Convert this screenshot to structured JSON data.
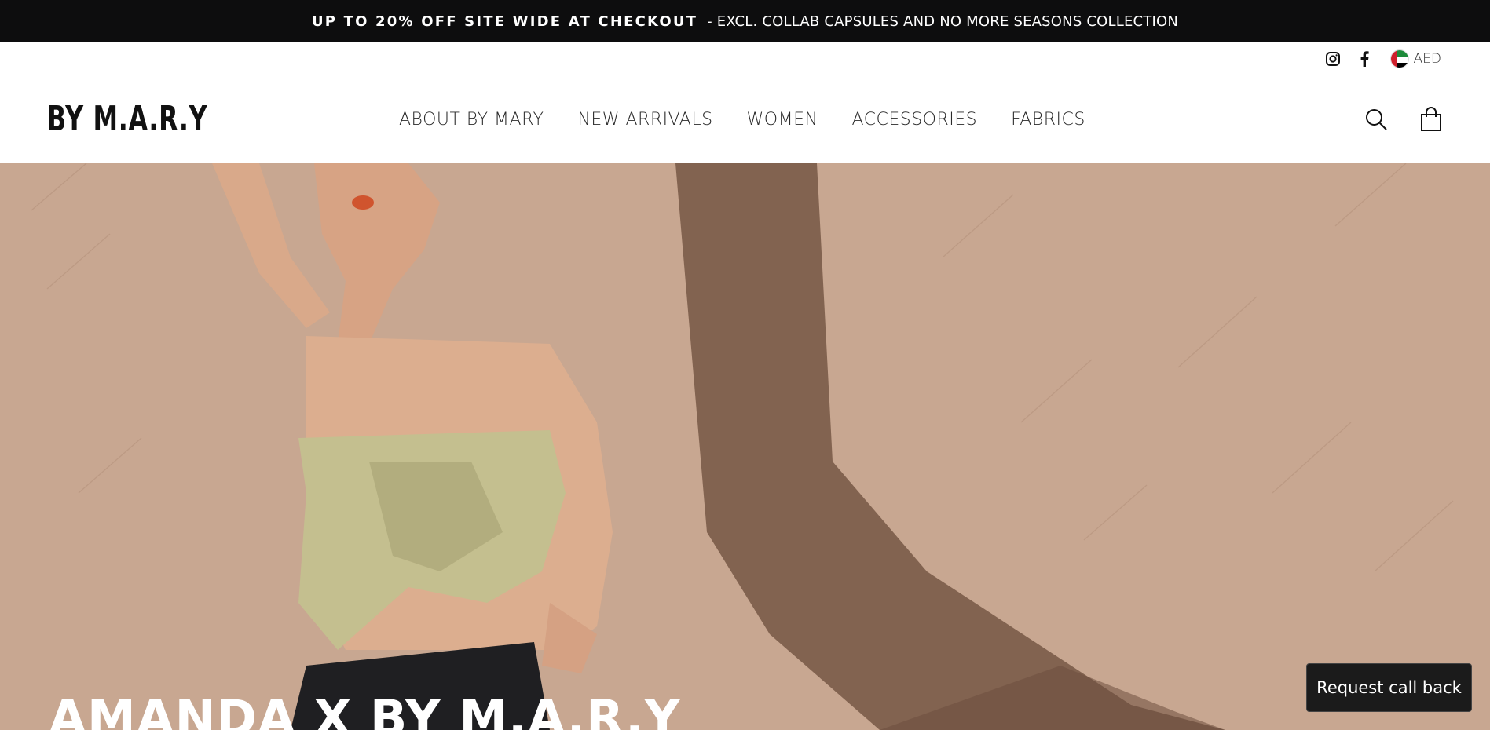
{
  "announcement": {
    "bold_text": "UP TO 20% OFF SITE WIDE AT CHECKOUT",
    "rest_text": "- EXCL. COLLAB CAPSULES AND NO MORE SEASONS COLLECTION"
  },
  "utility": {
    "social_icons": [
      "instagram-icon",
      "facebook-icon"
    ],
    "currency": {
      "flag": "uae-flag",
      "label": "AED"
    }
  },
  "header": {
    "logo": "BY M.A.R.Y",
    "nav": [
      {
        "label": "ABOUT BY MARY"
      },
      {
        "label": "NEW ARRIVALS"
      },
      {
        "label": "WOMEN"
      },
      {
        "label": "ACCESSORIES"
      },
      {
        "label": "FABRICS"
      }
    ],
    "icons": [
      "search-icon",
      "cart-icon"
    ]
  },
  "hero": {
    "title": "AMANDA X BY M.A.R.Y",
    "background_color": "#c7a690"
  },
  "callback_button": {
    "label": "Request call back"
  },
  "colors": {
    "announcement_bg": "#0d0d0e",
    "text": "#111111",
    "callback_bg": "#1b1b1b"
  }
}
